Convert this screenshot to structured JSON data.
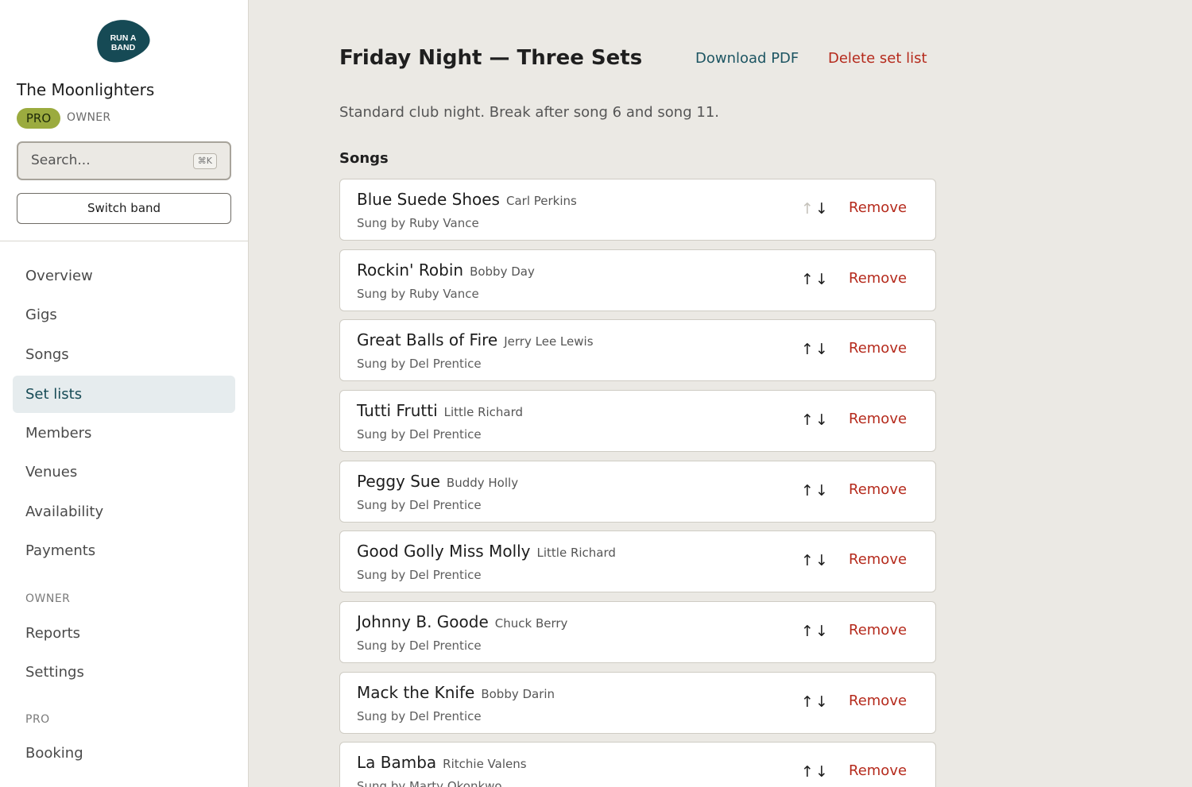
{
  "logo": {
    "text_line1": "RUN A",
    "text_line2": "BAND",
    "color": "#164a55"
  },
  "band": {
    "name": "The Moonlighters",
    "plan_badge": "PRO",
    "role": "OWNER"
  },
  "search": {
    "placeholder": "Search...",
    "shortcut": "⌘K"
  },
  "switch_band_label": "Switch band",
  "nav": {
    "items": [
      {
        "label": "Overview"
      },
      {
        "label": "Gigs"
      },
      {
        "label": "Songs"
      },
      {
        "label": "Set lists",
        "active": true
      },
      {
        "label": "Members"
      },
      {
        "label": "Venues"
      },
      {
        "label": "Availability"
      },
      {
        "label": "Payments"
      }
    ],
    "owner_section": "OWNER",
    "owner_items": [
      {
        "label": "Reports"
      },
      {
        "label": "Settings"
      }
    ],
    "pro_section": "PRO",
    "pro_items": [
      {
        "label": "Booking"
      }
    ]
  },
  "setlist": {
    "title": "Friday Night — Three Sets",
    "download_label": "Download PDF",
    "delete_label": "Delete set list",
    "description": "Standard club night. Break after song 6 and song 11.",
    "songs_heading": "Songs",
    "remove_label": "Remove",
    "songs": [
      {
        "title": "Blue Suede Shoes",
        "artist": "Carl Perkins",
        "singer": "Sung by Ruby Vance",
        "up_disabled": true
      },
      {
        "title": "Rockin' Robin",
        "artist": "Bobby Day",
        "singer": "Sung by Ruby Vance"
      },
      {
        "title": "Great Balls of Fire",
        "artist": "Jerry Lee Lewis",
        "singer": "Sung by Del Prentice"
      },
      {
        "title": "Tutti Frutti",
        "artist": "Little Richard",
        "singer": "Sung by Del Prentice"
      },
      {
        "title": "Peggy Sue",
        "artist": "Buddy Holly",
        "singer": "Sung by Del Prentice"
      },
      {
        "title": "Good Golly Miss Molly",
        "artist": "Little Richard",
        "singer": "Sung by Del Prentice"
      },
      {
        "title": "Johnny B. Goode",
        "artist": "Chuck Berry",
        "singer": "Sung by Del Prentice"
      },
      {
        "title": "Mack the Knife",
        "artist": "Bobby Darin",
        "singer": "Sung by Del Prentice"
      },
      {
        "title": "La Bamba",
        "artist": "Ritchie Valens",
        "singer": "Sung by Marty Okonkwo"
      }
    ]
  },
  "colors": {
    "accent": "#164a55",
    "danger": "#b52a1c",
    "badge": "#9bab3f",
    "background": "#ebe9e4"
  },
  "icons": {
    "move_up": "↑",
    "move_down": "↓"
  }
}
